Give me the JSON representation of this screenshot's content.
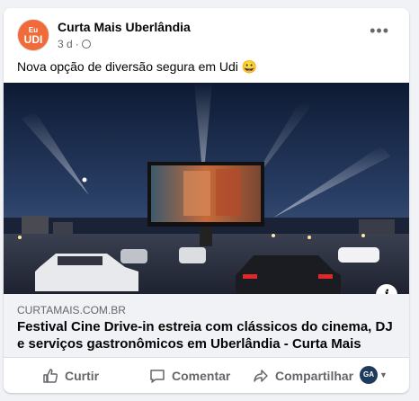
{
  "post": {
    "page_name": "Curta Mais Uberlândia",
    "avatar_top": "Eu",
    "avatar_bottom": "UDI",
    "time": "3 d",
    "time_separator": "·",
    "more_icon": "more-options-icon",
    "caption": "Nova opção de diversão segura em Udi 😀"
  },
  "link": {
    "domain": "CURTAMAIS.COM.BR",
    "title": "Festival Cine Drive-in estreia com clássicos do cinema, DJ e serviços gastronômicos em Uberlândia - Curta Mais",
    "info_icon_label": "i"
  },
  "actions": {
    "like": "Curtir",
    "comment": "Comentar",
    "share": "Compartilhar",
    "share_avatar": "GA"
  },
  "colors": {
    "brand_orange": "#ef6b3a",
    "secondary_text": "#65676b",
    "link_bg": "#f0f2f5"
  }
}
